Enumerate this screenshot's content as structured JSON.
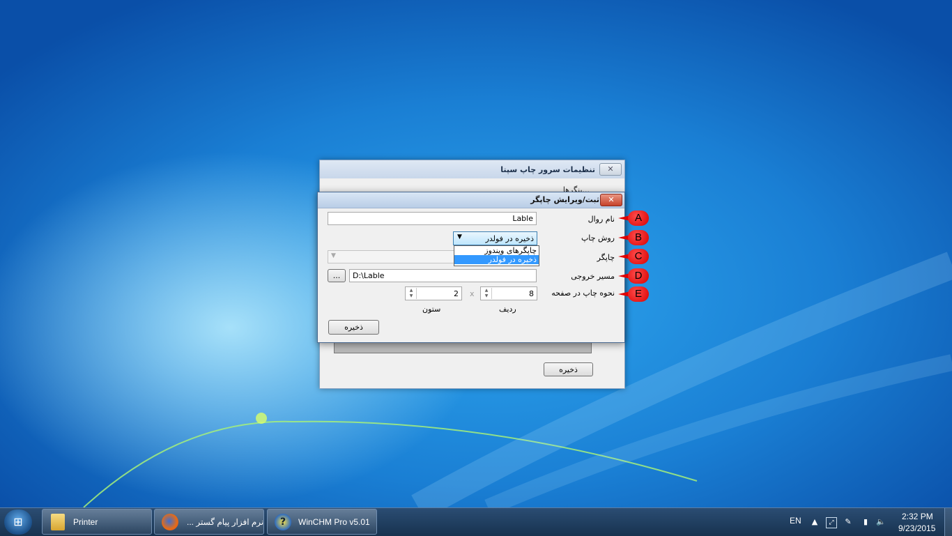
{
  "back_window": {
    "title": "تنظیمات سرور چاپ سپتا",
    "close_label": "✕",
    "partial_text": "...ینگرها",
    "save_label": "ذخیره"
  },
  "dialog": {
    "title": "ثبت/ویرایش چاپگر",
    "close_label": "✕",
    "fields": {
      "name_label": "نام روال",
      "name_value": "Lable",
      "method_label": "روش چاپ",
      "method_value": "ذخیره در فولدر",
      "printer_label": "چاپگر",
      "output_label": "مسیر خروجی",
      "output_value": "D:\\Lable",
      "browse_label": "...",
      "layout_label": "نحوه چاپ در صفحه",
      "rows_value": "8",
      "rows_label": "ردیف",
      "cols_value": "2",
      "cols_label": "ستون",
      "times_sep": "x"
    },
    "dropdown_options": [
      "چاپگرهای ویندوز",
      "ذخیره در فولدر"
    ],
    "dropdown_selected": "ذخیره در فولدر",
    "save_label": "ذخیره"
  },
  "markers": [
    "A",
    "B",
    "C",
    "D",
    "E"
  ],
  "taskbar": {
    "items": [
      {
        "label": "Printer",
        "icon": "folder-icon"
      },
      {
        "label": "نرم افزار پیام گستر ...",
        "icon": "firefox-icon"
      },
      {
        "label": "WinCHM Pro v5.01",
        "icon": "winchm-icon"
      }
    ],
    "language": "EN",
    "time": "2:32 PM",
    "date": "9/23/2015"
  },
  "colors": {
    "marker": "#e00000",
    "dropdown_highlight": "#3399ff",
    "taskbar": "#1f3d5f"
  }
}
